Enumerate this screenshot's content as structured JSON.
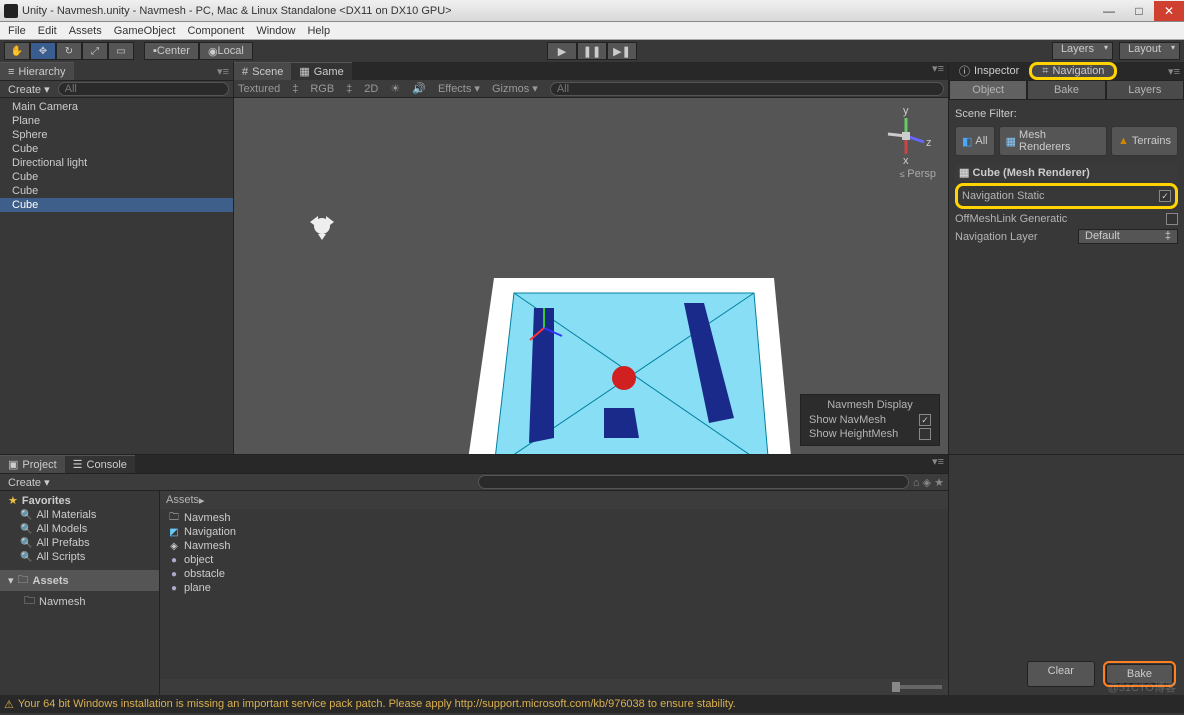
{
  "window": {
    "title": "Unity - Navmesh.unity - Navmesh - PC, Mac & Linux Standalone <DX11 on DX10 GPU>"
  },
  "menu": {
    "items": [
      "File",
      "Edit",
      "Assets",
      "GameObject",
      "Component",
      "Window",
      "Help"
    ]
  },
  "toolbar": {
    "pivot_center": "Center",
    "pivot_local": "Local",
    "layers": "Layers",
    "layout": "Layout"
  },
  "hierarchy": {
    "tab": "Hierarchy",
    "create": "Create",
    "search_placeholder": "All",
    "items": [
      "Main Camera",
      "Plane",
      "Sphere",
      "Cube",
      "Directional light",
      "Cube",
      "Cube",
      "Cube"
    ],
    "selected_index": 7
  },
  "scene": {
    "tabs": {
      "scene": "Scene",
      "game": "Game"
    },
    "toolbar": {
      "shading": "Textured",
      "color": "RGB",
      "twod": "2D",
      "effects": "Effects",
      "gizmos": "Gizmos",
      "search": "All"
    },
    "persp": "Persp",
    "navmesh_display": {
      "title": "Navmesh Display",
      "show_navmesh": "Show NavMesh",
      "show_heightmesh": "Show HeightMesh"
    }
  },
  "inspector": {
    "tabs": {
      "inspector": "Inspector",
      "navigation": "Navigation"
    },
    "subtabs": {
      "object": "Object",
      "bake": "Bake",
      "layers": "Layers"
    },
    "scene_filter": "Scene Filter:",
    "filters": {
      "all": "All",
      "mesh": "Mesh Renderers",
      "terrains": "Terrains"
    },
    "component": "Cube (Mesh Renderer)",
    "nav_static": "Navigation Static",
    "offmesh": "OffMeshLink Generatic",
    "nav_layer": "Navigation Layer",
    "nav_layer_value": "Default",
    "clear": "Clear",
    "bake": "Bake"
  },
  "project": {
    "tabs": {
      "project": "Project",
      "console": "Console"
    },
    "create": "Create",
    "favorites": "Favorites",
    "fav_items": [
      "All Materials",
      "All Models",
      "All Prefabs",
      "All Scripts"
    ],
    "assets": "Assets",
    "assets_children": [
      "Navmesh"
    ],
    "breadcrumb": "Assets",
    "files": [
      {
        "name": "Navmesh",
        "icon": "folder"
      },
      {
        "name": "Navigation",
        "icon": "cube"
      },
      {
        "name": "Navmesh",
        "icon": "unity"
      },
      {
        "name": "object",
        "icon": "material"
      },
      {
        "name": "obstacle",
        "icon": "material"
      },
      {
        "name": "plane",
        "icon": "material"
      }
    ]
  },
  "status": {
    "warning": "Your 64 bit Windows installation is missing an important service pack patch. Please apply http://support.microsoft.com/kb/976038 to ensure stability."
  },
  "watermark": "@51CTO博客"
}
